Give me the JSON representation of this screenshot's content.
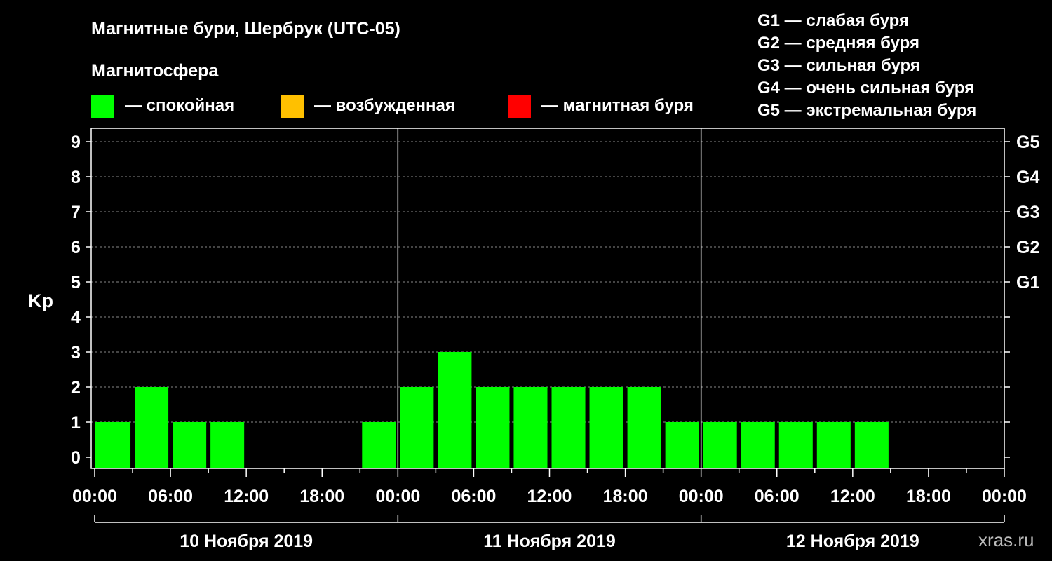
{
  "header": {
    "title": "Магнитные бури, Шербрук (UTC-05)",
    "subtitle": "Магнитосфера",
    "watermark": "xras.ru"
  },
  "legend": [
    {
      "label": "— спокойная",
      "color": "#00ff00"
    },
    {
      "label": "— возбужденная",
      "color": "#ffc000"
    },
    {
      "label": "— магнитная буря",
      "color": "#ff0000"
    }
  ],
  "storm_scale": [
    "G1 — слабая буря",
    "G2 — средняя буря",
    "G3 — сильная буря",
    "G4 — очень сильная буря",
    "G5 — экстремальная буря"
  ],
  "chart_data": {
    "type": "bar",
    "ylabel": "Kp",
    "ylim": [
      0,
      9
    ],
    "y_ticks": [
      "0",
      "1",
      "2",
      "3",
      "4",
      "5",
      "6",
      "7",
      "8",
      "9"
    ],
    "right_axis_labels": [
      {
        "level": 5,
        "label": "G1"
      },
      {
        "level": 6,
        "label": "G2"
      },
      {
        "level": 7,
        "label": "G3"
      },
      {
        "level": 8,
        "label": "G4"
      },
      {
        "level": 9,
        "label": "G5"
      }
    ],
    "x_tick_labels": [
      "00:00",
      "06:00",
      "12:00",
      "18:00",
      "00:00",
      "06:00",
      "12:00",
      "18:00",
      "00:00",
      "06:00",
      "12:00",
      "18:00",
      "00:00"
    ],
    "days": [
      "10 Ноября 2019",
      "11 Ноября 2019",
      "12 Ноября 2019"
    ],
    "interval_hours": 3,
    "grid": true,
    "series": [
      {
        "values": [
          1,
          2,
          1,
          1,
          null,
          null,
          null,
          1,
          2,
          3,
          2,
          2,
          2,
          2,
          2,
          1,
          1,
          1,
          1,
          1,
          1,
          null,
          null,
          null
        ],
        "color": "#00ff00"
      }
    ]
  }
}
